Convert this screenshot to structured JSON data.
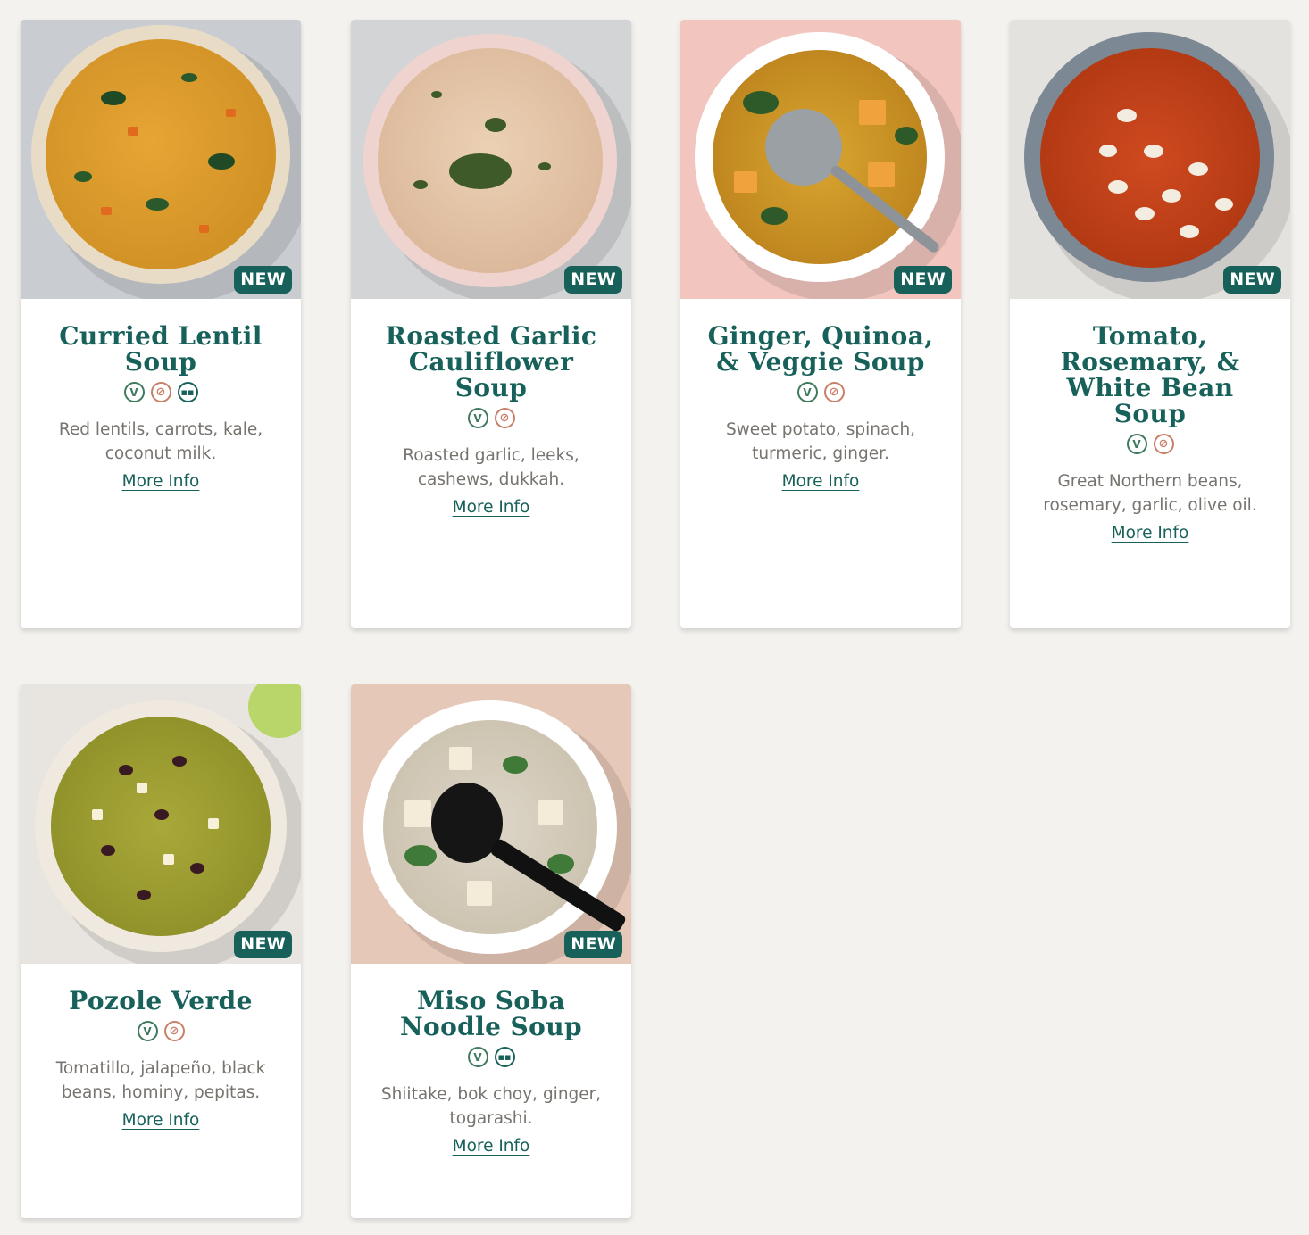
{
  "products": [
    {
      "title": "Curried Lentil Soup",
      "badge": "NEW",
      "description": "Red lentils, carrots, kale, coconut milk.",
      "more_info": "More Info",
      "diet_icons": [
        "vegan-icon",
        "gluten-free-icon",
        "protein-icon"
      ]
    },
    {
      "title": "Roasted Garlic Cauliflower Soup",
      "badge": "NEW",
      "description": "Roasted garlic, leeks, cashews, dukkah.",
      "more_info": "More Info",
      "diet_icons": [
        "vegan-icon",
        "gluten-free-icon"
      ]
    },
    {
      "title": "Ginger, Quinoa, & Veggie Soup",
      "badge": "NEW",
      "description": "Sweet potato, spinach, turmeric, ginger.",
      "more_info": "More Info",
      "diet_icons": [
        "vegan-icon",
        "gluten-free-icon"
      ]
    },
    {
      "title": "Tomato, Rosemary, & White Bean Soup",
      "badge": "NEW",
      "description": "Great Northern beans, rosemary, garlic, olive oil.",
      "more_info": "More Info",
      "diet_icons": [
        "vegan-icon",
        "gluten-free-icon"
      ]
    },
    {
      "title": "Pozole Verde",
      "badge": "NEW",
      "description": "Tomatillo, jalapeño, black beans, hominy, pepitas.",
      "more_info": "More Info",
      "diet_icons": [
        "vegan-icon",
        "gluten-free-icon"
      ]
    },
    {
      "title": "Miso Soba Noodle Soup",
      "badge": "NEW",
      "description": "Shiitake, bok choy, ginger, togarashi.",
      "more_info": "More Info",
      "diet_icons": [
        "vegan-icon",
        "protein-icon"
      ]
    }
  ],
  "colors": {
    "brand_green": "#17615a",
    "vegan_green": "#3f7a5d",
    "gluten_free_terracotta": "#c97f67",
    "page_background": "#f4f2ee"
  }
}
